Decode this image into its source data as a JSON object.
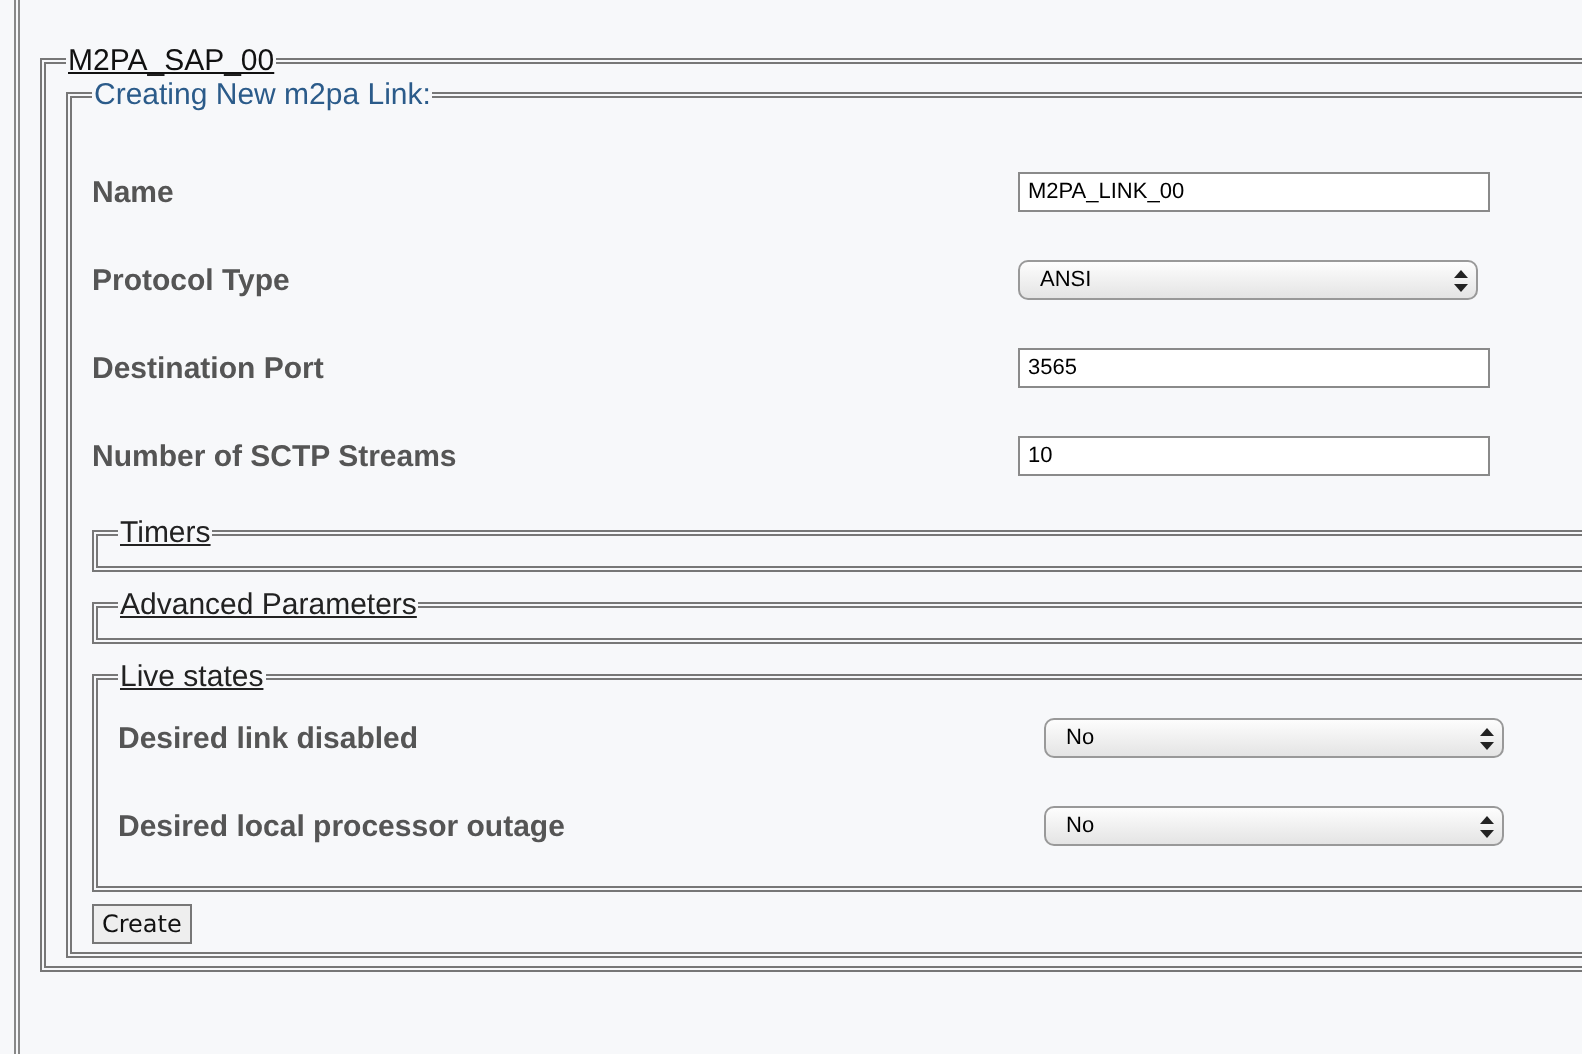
{
  "sap_panel": {
    "title": "M2PA_SAP_00"
  },
  "link_form": {
    "title": "Creating New m2pa Link:",
    "fields": [
      {
        "label": "Name",
        "kind": "text",
        "value": "M2PA_LINK_00"
      },
      {
        "label": "Protocol Type",
        "kind": "select",
        "value": "ANSI"
      },
      {
        "label": "Destination Port",
        "kind": "text",
        "value": "3565"
      },
      {
        "label": "Number of SCTP Streams",
        "kind": "text",
        "value": "10"
      }
    ],
    "sections": [
      {
        "title": "Timers"
      },
      {
        "title": "Advanced Parameters"
      },
      {
        "title": "Live states",
        "fields": [
          {
            "label": "Desired link disabled",
            "kind": "select",
            "value": "No"
          },
          {
            "label": "Desired local processor outage",
            "kind": "select",
            "value": "No"
          }
        ]
      }
    ],
    "create_button": "Create"
  }
}
